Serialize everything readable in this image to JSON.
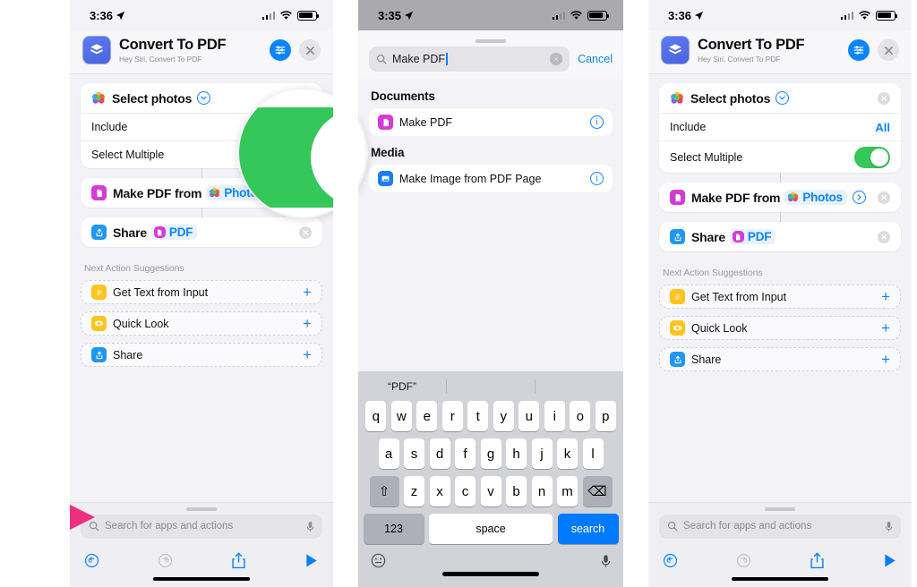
{
  "panel1": {
    "status": {
      "time": "3:36",
      "location_icon": "location-arrow-icon",
      "signal": "cellular-bars-icon",
      "wifi": "wifi-icon",
      "battery": "battery-icon"
    },
    "header": {
      "app_icon": "shortcuts-app-icon",
      "title": "Convert To PDF",
      "subtitle": "Hey Siri, Convert To PDF",
      "settings_label": "≡",
      "close_label": "×"
    },
    "actions": [
      {
        "icon": "photos-icon",
        "label": "Select photos",
        "chevron": "⌄",
        "has_clear": false
      },
      {
        "label": "Include",
        "value": ""
      },
      {
        "label": "Select Multiple",
        "value": ""
      }
    ],
    "make_pdf": {
      "icon": "pdf-file-icon",
      "label": "Make PDF from",
      "token_icon": "photos-icon",
      "token": "Photos"
    },
    "share": {
      "icon": "share-icon",
      "label": "Share",
      "token_icon": "pdf-file-icon",
      "token": "PDF"
    },
    "suggestions_title": "Next Action Suggestions",
    "suggestions": [
      {
        "icon": "text-doc-icon",
        "label": "Get Text from Input",
        "add": "+"
      },
      {
        "icon": "quick-look-icon",
        "label": "Quick Look",
        "add": "+"
      },
      {
        "icon": "share-icon",
        "label": "Share",
        "add": "+"
      }
    ],
    "search": {
      "placeholder": "Search for apps and actions",
      "search_icon": "search-icon",
      "mic_icon": "microphone-icon"
    },
    "toolbar": {
      "undo": "undo-icon",
      "redo": "redo-icon",
      "share": "share-icon",
      "play": "play-icon"
    }
  },
  "panel2": {
    "status": {
      "time": "3:35"
    },
    "search": {
      "value": "Make PDF",
      "clear_label": "×",
      "cancel_label": "Cancel",
      "search_icon": "search-icon"
    },
    "groups": [
      {
        "title": "Documents",
        "rows": [
          {
            "icon": "pdf-file-icon",
            "label": "Make PDF",
            "info": "i"
          }
        ]
      },
      {
        "title": "Media",
        "rows": [
          {
            "icon": "image-pdf-icon",
            "label": "Make Image from PDF Page",
            "info": "i"
          }
        ]
      }
    ],
    "keyboard": {
      "prediction": "“PDF”",
      "row1": [
        "q",
        "w",
        "e",
        "r",
        "t",
        "y",
        "u",
        "i",
        "o",
        "p"
      ],
      "row2": [
        "a",
        "s",
        "d",
        "f",
        "g",
        "h",
        "j",
        "k",
        "l"
      ],
      "row3": [
        "z",
        "x",
        "c",
        "v",
        "b",
        "n",
        "m"
      ],
      "shift_label": "⇧",
      "delete_label": "⌫",
      "numbers_label": "123",
      "space_label": "space",
      "search_label": "search",
      "emoji_icon": "emoji-icon",
      "dictate_icon": "microphone-icon"
    }
  },
  "panel3": {
    "status": {
      "time": "3:36"
    },
    "header": {
      "title": "Convert To PDF",
      "subtitle": "Hey Siri, Convert To PDF"
    },
    "actions": [
      {
        "label": "Select photos"
      },
      {
        "label": "Include",
        "value": "All"
      },
      {
        "label": "Select Multiple",
        "toggle": "on"
      }
    ],
    "make_pdf": {
      "label": "Make PDF from",
      "token": "Photos"
    },
    "share": {
      "label": "Share",
      "token": "PDF"
    },
    "suggestions_title": "Next Action Suggestions",
    "suggestions": [
      {
        "label": "Get Text from Input",
        "add": "+"
      },
      {
        "label": "Quick Look",
        "add": "+"
      },
      {
        "label": "Share",
        "add": "+"
      }
    ],
    "search": {
      "placeholder": "Search for apps and actions"
    }
  },
  "annotations": {
    "arrow": {
      "name": "pink-pointer-arrow",
      "color": "#ed2f7e"
    },
    "magnifier": {
      "name": "magnified-toggle-callout",
      "toggle_color": "#34c759"
    }
  }
}
